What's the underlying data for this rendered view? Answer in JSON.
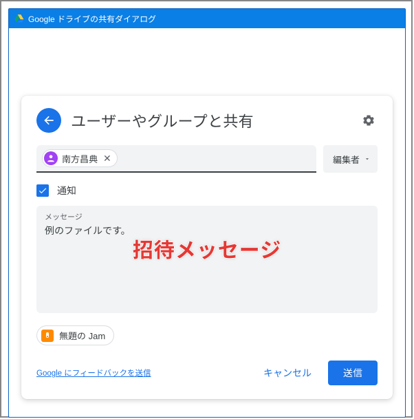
{
  "window": {
    "title": "Google ドライブの共有ダイアログ"
  },
  "dialog": {
    "title": "ユーザーやグループと共有",
    "role_selector": {
      "selected": "編集者"
    },
    "notify_label": "通知",
    "message": {
      "label": "メッセージ",
      "value": "例のファイルです。"
    },
    "overlay_annotation": "招待メッセージ",
    "attachment": {
      "name": "無題の Jam"
    },
    "feedback_link": "Google にフィードバックを送信",
    "cancel_label": "キャンセル",
    "send_label": "送信",
    "people": [
      {
        "name": "南方昌典"
      }
    ]
  }
}
